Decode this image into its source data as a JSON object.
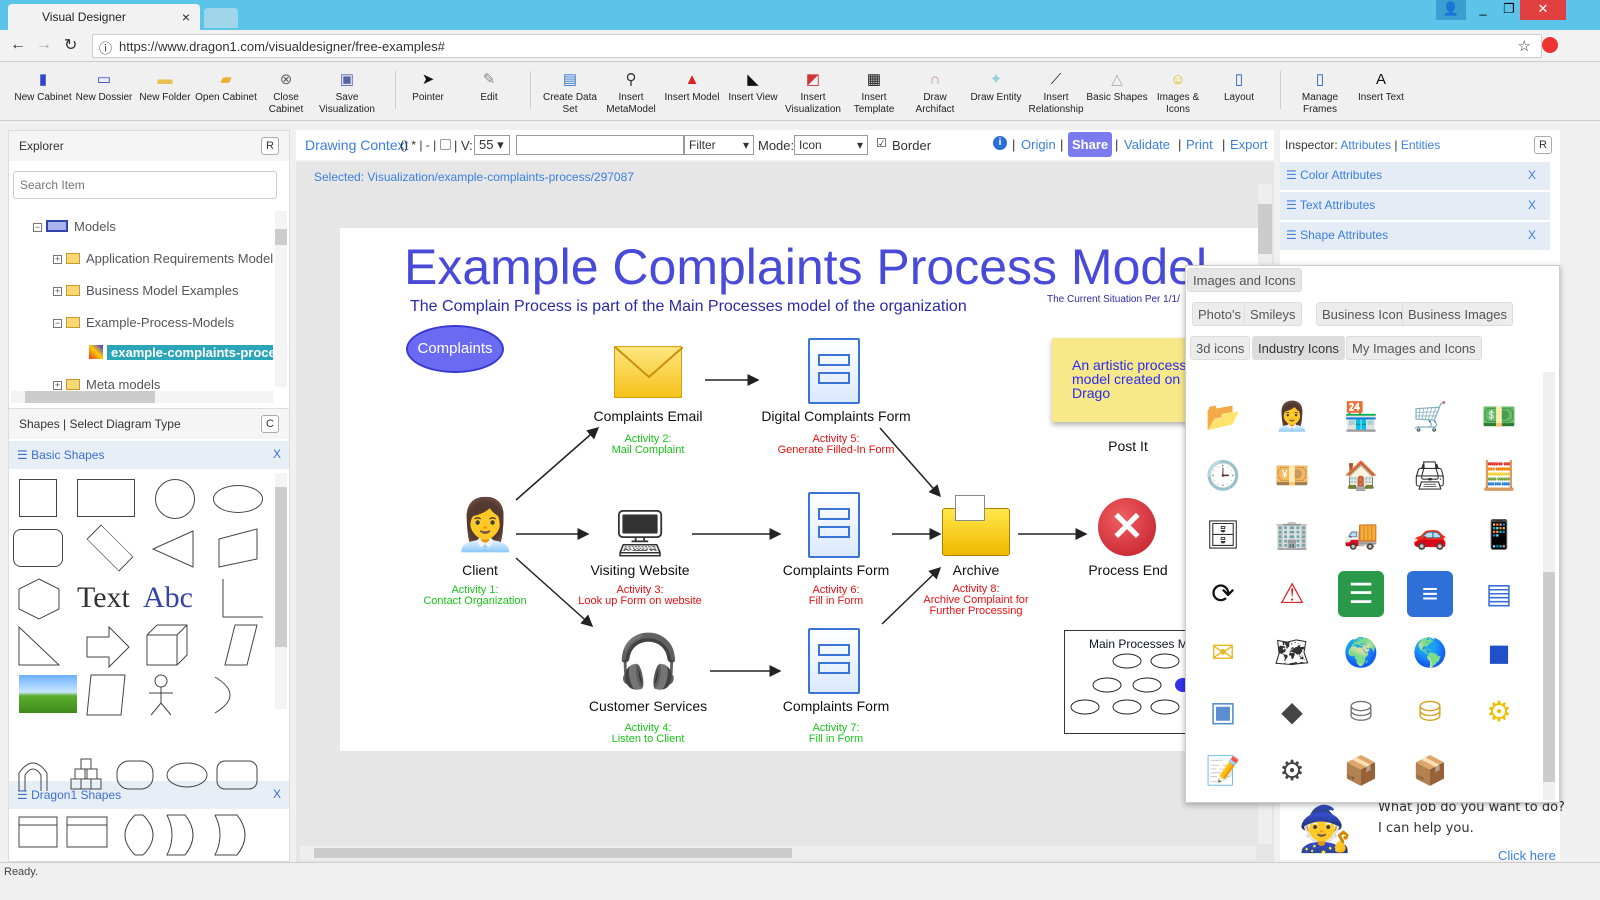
{
  "browser": {
    "tab_title": "Visual Designer",
    "url": "https://www.dragon1.com/visualdesigner/free-examples#"
  },
  "toolbar": [
    {
      "label": "New Cabinet",
      "icon": "cabinet-icon"
    },
    {
      "label": "New Dossier",
      "icon": "dossier-icon"
    },
    {
      "label": "New Folder",
      "icon": "folder-icon"
    },
    {
      "label": "Open Cabinet",
      "icon": "open-folder-icon"
    },
    {
      "label": "Close Cabinet",
      "icon": "close-icon"
    },
    {
      "label": "Save Visualization",
      "icon": "save-icon"
    },
    {
      "label": "Pointer",
      "icon": "pointer-icon"
    },
    {
      "label": "Edit",
      "icon": "edit-icon"
    },
    {
      "label": "Create Data Set",
      "icon": "dataset-icon"
    },
    {
      "label": "Insert MetaModel",
      "icon": "metamodel-icon"
    },
    {
      "label": "Insert Model",
      "icon": "model-icon"
    },
    {
      "label": "Insert View",
      "icon": "view-icon"
    },
    {
      "label": "Insert Visualization",
      "icon": "visualization-icon"
    },
    {
      "label": "Insert Template",
      "icon": "template-icon"
    },
    {
      "label": "Draw Archifact",
      "icon": "archifact-icon"
    },
    {
      "label": "Draw Entity",
      "icon": "entity-icon"
    },
    {
      "label": "Insert Relationship",
      "icon": "relationship-icon"
    },
    {
      "label": "Basic Shapes",
      "icon": "shapes-icon"
    },
    {
      "label": "Images & Icons",
      "icon": "smiley-icon"
    },
    {
      "label": "Layout",
      "icon": "layout-icon"
    },
    {
      "label": "Manage Frames",
      "icon": "frames-icon"
    },
    {
      "label": "Insert Text",
      "icon": "text-icon"
    }
  ],
  "explorer": {
    "title": "Explorer",
    "reset": "R",
    "search_placeholder": "Search Item",
    "tree": [
      {
        "label": "Models"
      },
      {
        "label": "Application Requirements Model"
      },
      {
        "label": "Business Model Examples"
      },
      {
        "label": "Example-Process-Models"
      },
      {
        "label": "example-complaints-process"
      },
      {
        "label": "Meta models"
      }
    ]
  },
  "shapes_panel": {
    "title": "Shapes | Select Diagram Type",
    "clear": "C",
    "basic_title": "Basic Shapes",
    "dragon_title": "Dragon1 Shapes",
    "close": "X",
    "text1": "Text",
    "text2": "Abc"
  },
  "context": {
    "drawing_context": "Drawing Context",
    "suffix": "() * | - |",
    "v_label": "| V:",
    "v_value": "55",
    "filter": "Filter",
    "mode_label": "Mode:",
    "mode_value": "Icon",
    "border": "Border",
    "border_checked": true,
    "origin": "Origin",
    "share": "Share",
    "validate": "Validate",
    "print": "Print",
    "export": "Export",
    "selected": "Selected: Visualization/example-complaints-process/297087"
  },
  "diagram": {
    "title": "Example Complaints Process Model",
    "subtitle": "The Complain Process is part of the Main Processes model of the organization",
    "situation": "The Current Situation Per 1/1/",
    "start": "Complaints",
    "postit": "An artistic process model created on Drago",
    "postit_label": "Post It",
    "nodes": [
      {
        "label": "Client",
        "act1": "Activity 1:",
        "act2": "Contact Organization",
        "color": "green"
      },
      {
        "label": "Complaints Email",
        "act1": "Activity 2:",
        "act2": "Mail Complaint",
        "color": "green"
      },
      {
        "label": "Visiting Website",
        "act1": "Activity 3:",
        "act2": "Look up Form on website",
        "color": "red"
      },
      {
        "label": "Customer Services",
        "act1": "Activity 4:",
        "act2": "Listen to Client",
        "color": "green"
      },
      {
        "label": "Digital Complaints Form",
        "act1": "Activity 5:",
        "act2": "Generate Filled-In Form",
        "color": "red"
      },
      {
        "label": "Complaints Form",
        "act1": "Activity 6:",
        "act2": "Fill in Form",
        "color": "red"
      },
      {
        "label": "Complaints Form",
        "act1": "Activity 7:",
        "act2": "Fill in Form",
        "color": "green"
      },
      {
        "label": "Archive",
        "act1": "Activity 8:",
        "act2": "Archive Complaint for",
        "act3": "Further Processing",
        "color": "red"
      },
      {
        "label": "Process End"
      }
    ],
    "main_processes": "Main Processes M",
    "mini_process": "process"
  },
  "inspector": {
    "label": "Inspector:",
    "attributes": "Attributes",
    "entities": "Entities",
    "reset": "R",
    "sections": [
      {
        "label": "Color Attributes"
      },
      {
        "label": "Text Attributes"
      },
      {
        "label": "Shape Attributes"
      }
    ],
    "close": "X"
  },
  "images_popup": {
    "title": "Images and Icons",
    "tabs": [
      "Photo's",
      "Smileys",
      "Business Icons",
      "Business Images",
      "3d icons",
      "Industry Icons",
      "My Images and Icons"
    ],
    "selected_tab": "Industry Icons",
    "icons": [
      "folder-docs-icon",
      "businesswoman-icon",
      "store-icon",
      "cart-icon",
      "money-icon",
      "clock-icon",
      "cash-icon",
      "house-icon",
      "printer-icon",
      "calculator-icon",
      "server-icon",
      "building-icon",
      "truck-icon",
      "car-icon",
      "phone-icon",
      "refresh-icon",
      "warning-icon",
      "list-icon",
      "document-icon",
      "form-icon",
      "mail-icon",
      "world-map-icon",
      "globe-icon",
      "globe2-icon",
      "cube-icon",
      "box-icon",
      "dark-cube-icon",
      "database-icon",
      "gold-database-icon",
      "gear-icon",
      "contract-icon",
      "hand-gear-icon",
      "package-icon",
      "gold-box-icon"
    ]
  },
  "assistant": {
    "line1": "What job do you want to do?",
    "line2": "I can help you.",
    "link": "Click here"
  },
  "status": "Ready."
}
